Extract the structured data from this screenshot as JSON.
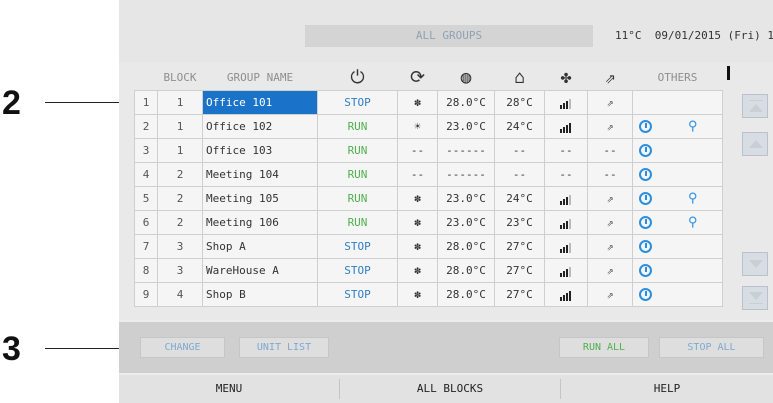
{
  "callouts": {
    "a": "2",
    "b": "3"
  },
  "header": {
    "group_title": "ALL GROUPS",
    "temperature": "11°C",
    "date": "09/01/2015 (Fri) 16:1"
  },
  "columns": {
    "block": "BLOCK",
    "group_name": "GROUP NAME",
    "others": "OTHERS",
    "icons": [
      "power-icon",
      "mode-icon",
      "setpoint-icon",
      "room-temp-icon",
      "fan-speed-icon",
      "air-direction-icon"
    ]
  },
  "rows": [
    {
      "idx": "1",
      "block": "1",
      "name": "Office 101",
      "status": "STOP",
      "mode": "✽",
      "set": "28.0°C",
      "room": "28°C",
      "fan": "3",
      "dir": "⇗",
      "timer": false,
      "fanicon": false
    },
    {
      "idx": "2",
      "block": "1",
      "name": "Office 102",
      "status": "RUN",
      "mode": "☀",
      "set": "23.0°C",
      "room": "24°C",
      "fan": "4",
      "dir": "⇗",
      "timer": true,
      "fanicon": true
    },
    {
      "idx": "3",
      "block": "1",
      "name": "Office 103",
      "status": "RUN",
      "mode": "--",
      "set": "------",
      "room": "--",
      "fan": "--",
      "dir": "--",
      "timer": true,
      "fanicon": false
    },
    {
      "idx": "4",
      "block": "2",
      "name": "Meeting 104",
      "status": "RUN",
      "mode": "--",
      "set": "------",
      "room": "--",
      "fan": "--",
      "dir": "--",
      "timer": true,
      "fanicon": false
    },
    {
      "idx": "5",
      "block": "2",
      "name": "Meeting 105",
      "status": "RUN",
      "mode": "✽",
      "set": "23.0°C",
      "room": "24°C",
      "fan": "3",
      "dir": "⇗",
      "timer": true,
      "fanicon": true
    },
    {
      "idx": "6",
      "block": "2",
      "name": "Meeting 106",
      "status": "RUN",
      "mode": "✽",
      "set": "23.0°C",
      "room": "23°C",
      "fan": "3",
      "dir": "⇗",
      "timer": true,
      "fanicon": true
    },
    {
      "idx": "7",
      "block": "3",
      "name": "Shop A",
      "status": "STOP",
      "mode": "✽",
      "set": "28.0°C",
      "room": "27°C",
      "fan": "3",
      "dir": "⇗",
      "timer": true,
      "fanicon": false
    },
    {
      "idx": "8",
      "block": "3",
      "name": "WareHouse A",
      "status": "STOP",
      "mode": "✽",
      "set": "28.0°C",
      "room": "27°C",
      "fan": "3",
      "dir": "⇗",
      "timer": true,
      "fanicon": false
    },
    {
      "idx": "9",
      "block": "4",
      "name": "Shop B",
      "status": "STOP",
      "mode": "✽",
      "set": "28.0°C",
      "room": "27°C",
      "fan": "4",
      "dir": "⇗",
      "timer": true,
      "fanicon": false
    }
  ],
  "actions": {
    "change": "CHANGE",
    "unit_list": "UNIT LIST",
    "run_all": "RUN ALL",
    "stop_all": "STOP ALL"
  },
  "footer": {
    "menu": "MENU",
    "all_blocks": "ALL BLOCKS",
    "help": "HELP"
  },
  "colors": {
    "run": "#4fb04f",
    "stop": "#2f7fc1",
    "selected": "#1a73c8",
    "timer": "#2b8fe0"
  }
}
